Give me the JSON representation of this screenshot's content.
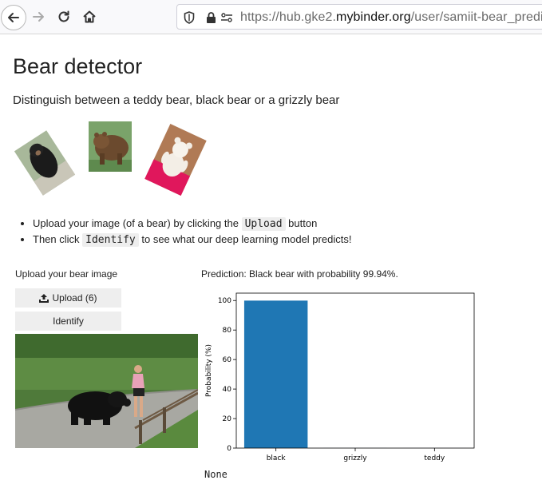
{
  "browser": {
    "url_prefix": "https://hub.gke2.",
    "url_host": "mybinder.org",
    "url_path": "/user/samiit-bear_predi"
  },
  "page": {
    "title": "Bear detector",
    "subtitle": "Distinguish between a teddy bear, black bear or a grizzly bear",
    "instructions": [
      {
        "before": "Upload your image (of a bear) by clicking the ",
        "code": "Upload",
        "after": " button"
      },
      {
        "before": "Then click ",
        "code": "Identify",
        "after": " to see what our deep learning model predicts!"
      }
    ],
    "upload_label": "Upload your bear image",
    "upload_button": "Upload (6)",
    "identify_button": "Identify",
    "prediction_text": "Prediction: Black bear with probability 99.94%.",
    "output_text": "None"
  },
  "chart_data": {
    "type": "bar",
    "categories": [
      "black",
      "grizzly",
      "teddy"
    ],
    "values": [
      99.94,
      0.05,
      0.01
    ],
    "ylabel": "Probability (%)",
    "ylim": [
      0,
      105
    ],
    "yticks": [
      0,
      20,
      40,
      60,
      80,
      100
    ],
    "bar_color": "#1f77b4",
    "grid": false
  }
}
